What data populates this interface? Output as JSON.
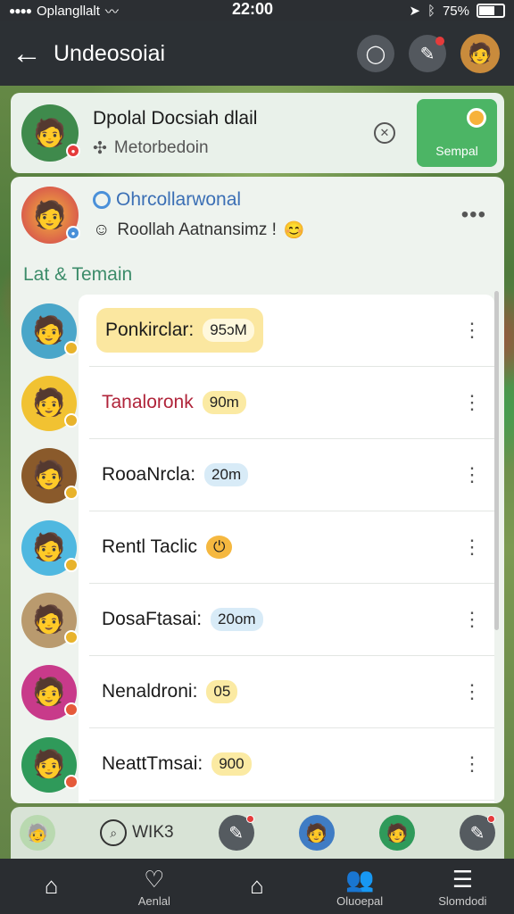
{
  "status_bar": {
    "carrier": "Oplangllalt",
    "time": "22:00",
    "battery": "75%"
  },
  "header": {
    "title": "Undeosoiai",
    "icons": [
      "chat-bubble-icon",
      "pen-icon",
      "profile-avatar"
    ]
  },
  "top_card": {
    "title": "Dpolal Docsiah dlail",
    "subtitle": "Metorbedoin",
    "send_label": "Sempal"
  },
  "profile": {
    "name": "Ohrcollarwonal",
    "status": "Roollah Aatnansimz !"
  },
  "section_title": "Lat & Temain",
  "list": [
    {
      "name": "Ponkirclar:",
      "pill": "95ɔM",
      "pill_style": "yellow",
      "highlight": true,
      "badge_color": "#e8b32b",
      "avatar_bg": "#4aa6c9"
    },
    {
      "name": "Tanaloronk",
      "pill": "90m",
      "pill_style": "yellow",
      "name_color": "red",
      "badge_color": "#e8b32b",
      "avatar_bg": "#f1c232"
    },
    {
      "name": "RooaNrcla:",
      "pill": "20m",
      "pill_style": "blue",
      "badge_color": "#e8b32b",
      "avatar_bg": "#8a5a2b"
    },
    {
      "name": "Rentl Taclic",
      "pill": "",
      "pill_style": "",
      "emoji": "⏻",
      "badge_color": "#e8b32b",
      "avatar_bg": "#4fb8e0"
    },
    {
      "name": "DosaFtasai:",
      "pill": "20om",
      "pill_style": "blue",
      "badge_color": "#e8b32b",
      "avatar_bg": "#b99a6e"
    },
    {
      "name": "Nenaldroni:",
      "pill": "05",
      "pill_style": "yellow",
      "badge_color": "#e55a3a",
      "avatar_bg": "#c83a8a"
    },
    {
      "name": "NeattTmsai:",
      "pill": "900",
      "pill_style": "yellow",
      "badge_color": "#e55a3a",
      "avatar_bg": "#2f9a5a"
    }
  ],
  "dock": {
    "search_label": "WIK3"
  },
  "nav": [
    {
      "icon": "home-icon",
      "label": ""
    },
    {
      "icon": "heart-check-icon",
      "label": "Aenlal"
    },
    {
      "icon": "house-outline-icon",
      "label": ""
    },
    {
      "icon": "people-icon",
      "label": "Oluoepal"
    },
    {
      "icon": "menu-icon",
      "label": "Slomdodi"
    }
  ],
  "colors": {
    "accent_green": "#4cb565",
    "header_bg": "#2c3034",
    "section_green": "#3c8c6a"
  }
}
